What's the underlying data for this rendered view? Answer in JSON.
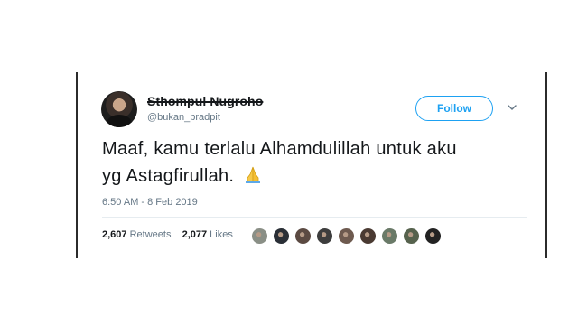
{
  "tweet": {
    "display_name": "Sthompul Nugroho",
    "handle": "@bukan_bradpit",
    "follow_label": "Follow",
    "text_line1": "Maaf, kamu terlalu Alhamdulillah untuk aku",
    "text_line2": "yg Astagfirullah.",
    "emoji": "folded-hands-emoji",
    "timestamp": "6:50 AM - 8 Feb 2019",
    "retweets_count": "2,607",
    "retweets_label": "Retweets",
    "likes_count": "2,077",
    "likes_label": "Likes"
  },
  "likers": [
    {
      "icon": "liker-avatar-1",
      "color": "#8a8f86"
    },
    {
      "icon": "liker-avatar-2",
      "color": "#2a2f36"
    },
    {
      "icon": "liker-avatar-3",
      "color": "#5b4a42"
    },
    {
      "icon": "liker-avatar-4",
      "color": "#3d3d3d"
    },
    {
      "icon": "liker-avatar-5",
      "color": "#6e5a4f"
    },
    {
      "icon": "liker-avatar-6",
      "color": "#4a3a32"
    },
    {
      "icon": "liker-avatar-7",
      "color": "#6a7a68"
    },
    {
      "icon": "liker-avatar-8",
      "color": "#56624d"
    },
    {
      "icon": "liker-avatar-9",
      "color": "#222222"
    }
  ],
  "colors": {
    "accent": "#1da1f2",
    "text_primary": "#14171a",
    "text_secondary": "#657786",
    "divider": "#e6ecf0"
  }
}
